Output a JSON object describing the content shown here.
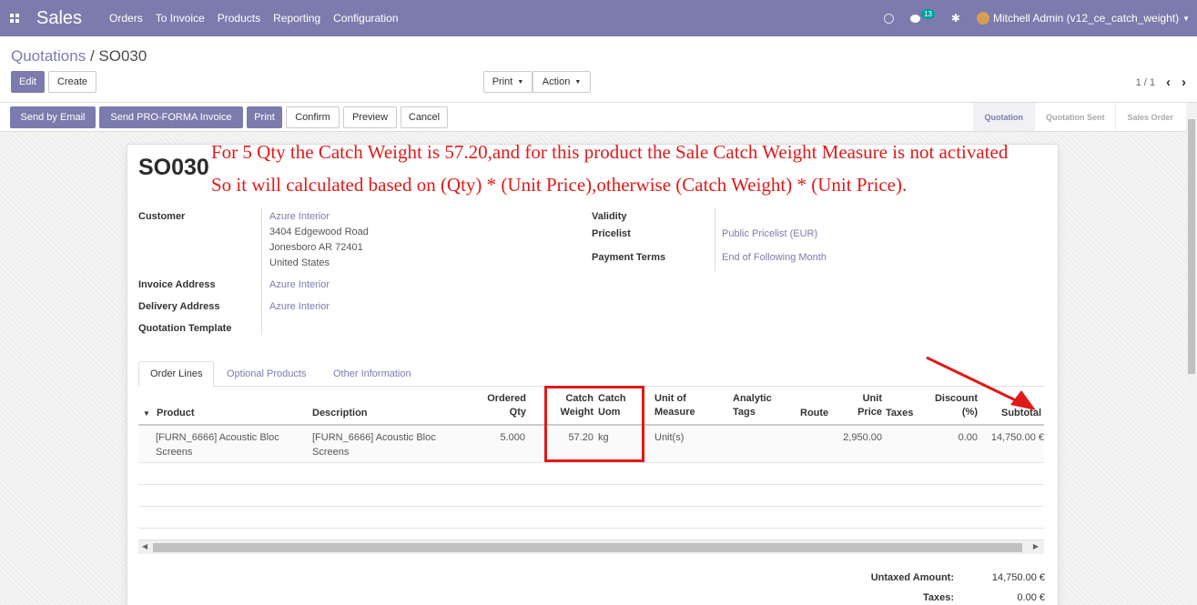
{
  "navbar": {
    "app_name": "Sales",
    "menu": [
      "Orders",
      "To Invoice",
      "Products",
      "Reporting",
      "Configuration"
    ],
    "chat_count": "13",
    "user": "Mitchell Admin (v12_ce_catch_weight)",
    "accent_color": "#7c7bad"
  },
  "breadcrumb": {
    "parent": "Quotations",
    "separator": " / ",
    "current": "SO030"
  },
  "toolbar": {
    "edit": "Edit",
    "create": "Create",
    "print": "Print",
    "action": "Action"
  },
  "pager": {
    "value": "1 / 1"
  },
  "statusbar": {
    "buttons": {
      "send_email": "Send by Email",
      "proforma": "Send PRO-FORMA Invoice",
      "print": "Print",
      "confirm": "Confirm",
      "preview": "Preview",
      "cancel": "Cancel"
    },
    "stages": [
      "Quotation",
      "Quotation Sent",
      "Sales Order"
    ]
  },
  "form": {
    "title": "SO030",
    "annotation_line1": "For 5 Qty the Catch Weight is 57.20,and for this product the Sale Catch Weight Measure is not activated",
    "annotation_line2": "So it will calculated based on (Qty) * (Unit Price),otherwise (Catch Weight) * (Unit Price).",
    "labels": {
      "customer": "Customer",
      "invoice_address": "Invoice Address",
      "delivery_address": "Delivery Address",
      "quotation_template": "Quotation Template",
      "validity": "Validity",
      "pricelist": "Pricelist",
      "payment_terms": "Payment Terms"
    },
    "customer": {
      "name": "Azure Interior",
      "street": "3404 Edgewood Road",
      "city": "Jonesboro AR 72401",
      "country": "United States"
    },
    "invoice_address": "Azure Interior",
    "delivery_address": "Azure Interior",
    "pricelist": "Public Pricelist (EUR)",
    "payment_terms": "End of Following Month"
  },
  "tabs": [
    "Order Lines",
    "Optional Products",
    "Other Information"
  ],
  "table": {
    "headers": {
      "product": "Product",
      "description": "Description",
      "ordered_qty_1": "Ordered",
      "ordered_qty_2": "Qty",
      "catch_weight_1": "Catch",
      "catch_weight_2": "Weight",
      "catch_uom_1": "Catch",
      "catch_uom_2": "Uom",
      "uom_1": "Unit of",
      "uom_2": "Measure",
      "analytic_1": "Analytic",
      "analytic_2": "Tags",
      "route": "Route",
      "unit_price_1": "Unit",
      "unit_price_2": "Price",
      "taxes": "Taxes",
      "discount_1": "Discount",
      "discount_2": "(%)",
      "subtotal": "Subtotal"
    },
    "row": {
      "product_1": "[FURN_6666] Acoustic Bloc",
      "product_2": "Screens",
      "description_1": "[FURN_6666] Acoustic Bloc",
      "description_2": "Screens",
      "qty": "5.000",
      "catch_weight": "57.20",
      "catch_uom": "kg",
      "uom": "Unit(s)",
      "unit_price": "2,950.00",
      "discount": "0.00",
      "subtotal": "14,750.00 €"
    }
  },
  "totals": {
    "untaxed_label": "Untaxed Amount:",
    "untaxed_value": "14,750.00 €",
    "taxes_label": "Taxes:",
    "taxes_value": "0.00 €"
  }
}
